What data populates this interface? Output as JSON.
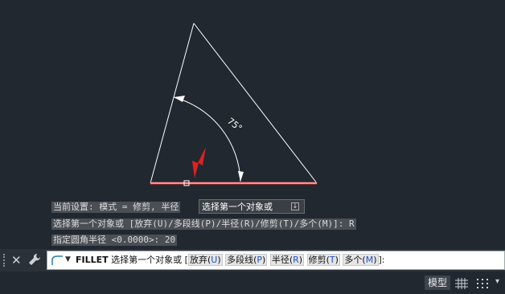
{
  "drawing": {
    "angle_label": "75°"
  },
  "tooltip": {
    "text": "选择第一个对象或"
  },
  "history": {
    "line1": "当前设置: 模式 = 修剪, 半径",
    "line2": "选择第一个对象或 [放弃(U)/多段线(P)/半径(R)/修剪(T)/多个(M)]: R",
    "line3": "指定圆角半径 <0.0000>: 20"
  },
  "command_line": {
    "command": "FILLET",
    "prompt": "选择第一个对象或 [",
    "options": [
      {
        "label": "放弃",
        "key": "U"
      },
      {
        "label": "多段线",
        "key": "P"
      },
      {
        "label": "半径",
        "key": "R"
      },
      {
        "label": "修剪",
        "key": "T"
      },
      {
        "label": "多个",
        "key": "M"
      }
    ],
    "suffix": "]:"
  },
  "status_bar": {
    "model_label": "模型"
  },
  "colors": {
    "background": "#212830",
    "selected_line": "#e03030",
    "arrow": "#e02020",
    "triangle": "#ffffff"
  },
  "icons": [
    "close-icon",
    "wrench-icon",
    "fillet-icon",
    "dropdown-icon",
    "grid-icon",
    "snap-icon",
    "menu-icon",
    "download-icon"
  ]
}
